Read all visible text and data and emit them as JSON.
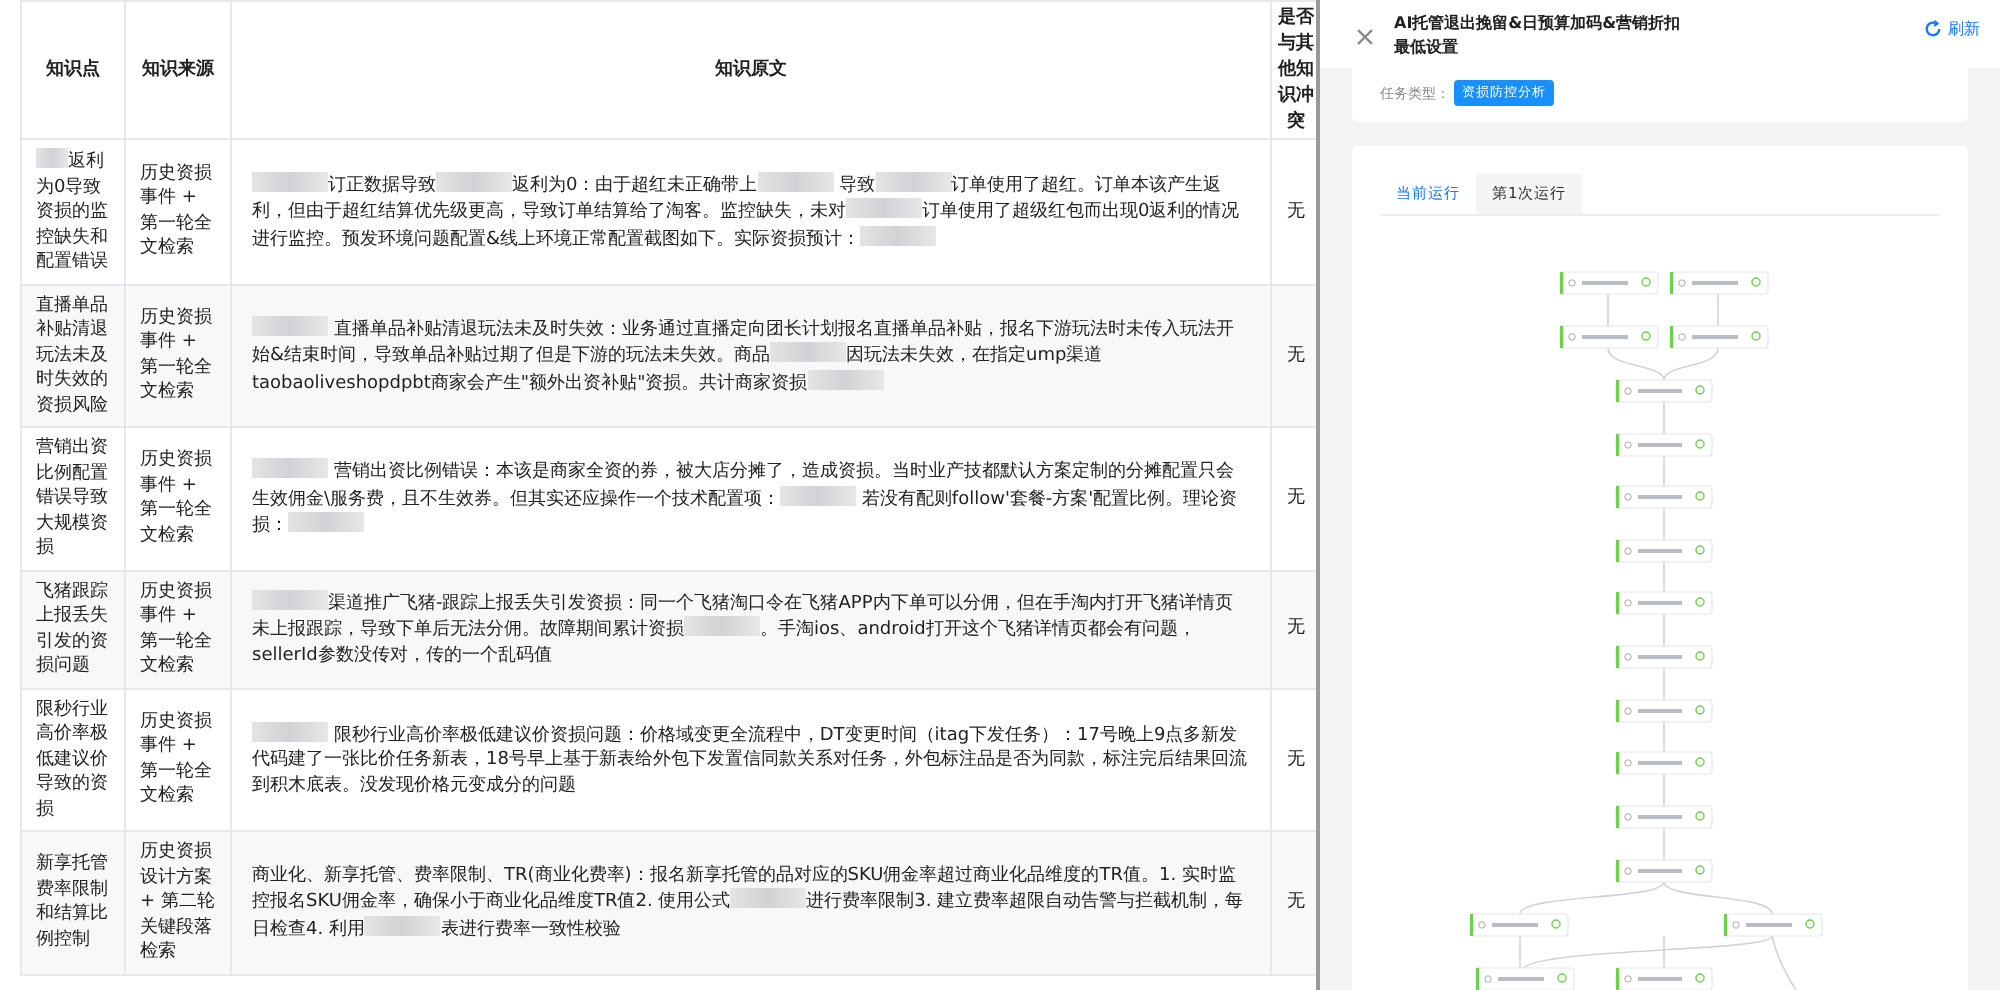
{
  "table": {
    "columns": [
      "知识点",
      "知识来源",
      "知识原文",
      "是否与其他知识冲突"
    ],
    "rows": [
      {
        "point": [
          {
            "kind": "redacted"
          },
          {
            "kind": "text",
            "text": "返利为0导致资损的监控缺失和配置错误"
          }
        ],
        "source": "历史资损事件 + 第一轮全文检索",
        "text": [
          {
            "kind": "redacted"
          },
          {
            "kind": "text",
            "text": "订正数据导致"
          },
          {
            "kind": "redacted"
          },
          {
            "kind": "text",
            "text": "返利为0：由于超红未正确带上"
          },
          {
            "kind": "redacted"
          },
          {
            "kind": "text",
            "text": " 导致"
          },
          {
            "kind": "redacted"
          },
          {
            "kind": "text",
            "text": "订单使用了超红。订单本该产生返利，但由于超红结算优先级更高，导致订单结算给了淘客。监控缺失，未对"
          },
          {
            "kind": "redacted"
          },
          {
            "kind": "text",
            "text": "订单使用了超级红包而出现0返利的情况进行监控。预发环境问题配置&线上环境正常配置截图如下。实际资损预计："
          },
          {
            "kind": "redacted"
          }
        ],
        "conflict": "无"
      },
      {
        "point": [
          {
            "kind": "text",
            "text": "直播单品补贴清退玩法未及时失效的资损风险"
          }
        ],
        "source": "历史资损事件 + 第一轮全文检索",
        "text": [
          {
            "kind": "redacted"
          },
          {
            "kind": "text",
            "text": " 直播单品补贴清退玩法未及时失效：业务通过直播定向团长计划报名直播单品补贴，报名下游玩法时未传入玩法开始&结束时间，导致单品补贴过期了但是下游的玩法未失效。商品"
          },
          {
            "kind": "redacted"
          },
          {
            "kind": "text",
            "text": "因玩法未失效，在指定ump渠道taobaoliveshopdpbt商家会产生\"额外出资补贴\"资损。共计商家资损"
          },
          {
            "kind": "redacted"
          }
        ],
        "conflict": "无"
      },
      {
        "point": [
          {
            "kind": "text",
            "text": "营销出资比例配置错误导致大规模资损"
          }
        ],
        "source": "历史资损事件 + 第一轮全文检索",
        "text": [
          {
            "kind": "redacted"
          },
          {
            "kind": "text",
            "text": " 营销出资比例错误：本该是商家全资的券，被大店分摊了，造成资损。当时业产技都默认方案定制的分摊配置只会生效佣金\\服务费，且不生效券。但其实还应操作一个技术配置项："
          },
          {
            "kind": "redacted"
          },
          {
            "kind": "text",
            "text": " 若没有配则follow'套餐-方案'配置比例。理论资损："
          },
          {
            "kind": "redacted"
          }
        ],
        "conflict": "无"
      },
      {
        "point": [
          {
            "kind": "text",
            "text": "飞猪跟踪上报丢失引发的资损问题"
          }
        ],
        "source": "历史资损事件 + 第一轮全文检索",
        "text": [
          {
            "kind": "redacted"
          },
          {
            "kind": "text",
            "text": "渠道推广飞猪-跟踪上报丢失引发资损：同一个飞猪淘口令在飞猪APP内下单可以分佣，但在手淘内打开飞猪详情页未上报跟踪，导致下单后无法分佣。故障期间累计资损"
          },
          {
            "kind": "redacted"
          },
          {
            "kind": "text",
            "text": "。手淘ios、android打开这个飞猪详情页都会有问题，sellerId参数没传对，传的一个乱码值"
          }
        ],
        "conflict": "无"
      },
      {
        "point": [
          {
            "kind": "text",
            "text": "限秒行业高价率极低建议价导致的资损"
          }
        ],
        "source": "历史资损事件 + 第一轮全文检索",
        "text": [
          {
            "kind": "redacted"
          },
          {
            "kind": "text",
            "text": " 限秒行业高价率极低建议价资损问题：价格域变更全流程中，DT变更时间（itag下发任务）：17号晚上9点多新发代码建了一张比价任务新表，18号早上基于新表给外包下发置信同款关系对任务，外包标注品是否为同款，标注完后结果回流到积木底表。没发现价格元变成分的问题"
          }
        ],
        "conflict": "无"
      },
      {
        "point": [
          {
            "kind": "text",
            "text": "新享托管费率限制和结算比例控制"
          }
        ],
        "source": "历史资损设计方案 + 第二轮关键段落检索",
        "text": [
          {
            "kind": "text",
            "text": "商业化、新享托管、费率限制、TR(商业化费率)：报名新享托管的品对应的SKU佣金率超过商业化品维度的TR值。1. 实时监控报名SKU佣金率，确保小于商业化品维度TR值2. 使用公式"
          },
          {
            "kind": "redacted"
          },
          {
            "kind": "text",
            "text": "进行费率限制3. 建立费率超限自动告警与拦截机制，每日检查4. 利用"
          },
          {
            "kind": "redacted"
          },
          {
            "kind": "text",
            "text": "表进行费率一致性校验"
          }
        ],
        "conflict": "无"
      }
    ]
  },
  "panel": {
    "title": "AI托管退出挽留&日预算加码&营销折扣最低设置",
    "refresh": "刷新",
    "task_type_label": "任务类型：",
    "task_type": "资损防控分析",
    "tabs": [
      {
        "label": "当前运行",
        "selected": true
      },
      {
        "label": "第1次运行",
        "selected": false
      }
    ]
  }
}
